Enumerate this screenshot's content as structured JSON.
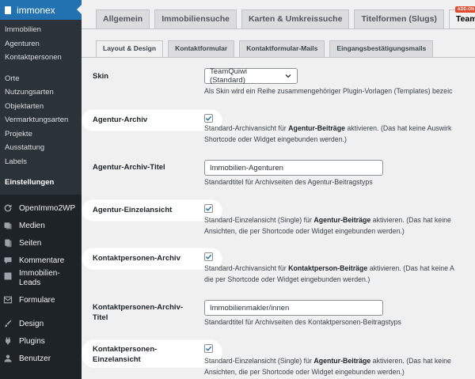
{
  "sidebar": {
    "title": "immonex",
    "submenu": [
      "Immobilien",
      "Agenturen",
      "Kontaktpersonen"
    ],
    "submenu2": [
      "Orte",
      "Nutzungsarten",
      "Objektarten",
      "Vermarktungsarten",
      "Projekte",
      "Ausstattung",
      "Labels"
    ],
    "current": "Einstellungen",
    "menu": [
      {
        "label": "OpenImmo2WP",
        "icon": "refresh-icon"
      },
      {
        "label": "Medien",
        "icon": "media-icon"
      },
      {
        "label": "Seiten",
        "icon": "pages-icon"
      },
      {
        "label": "Kommentare",
        "icon": "comments-icon"
      },
      {
        "label": "Immobilien-\nLeads",
        "icon": "leads-icon"
      },
      {
        "label": "Formulare",
        "icon": "forms-icon"
      },
      {
        "label": "Design",
        "icon": "brush-icon"
      },
      {
        "label": "Plugins",
        "icon": "plugin-icon"
      },
      {
        "label": "Benutzer",
        "icon": "user-icon"
      }
    ]
  },
  "tabs_primary": [
    "Allgemein",
    "Immobiliensuche",
    "Karten & Umkreissuche",
    "Titelformen (Slugs)",
    "Team"
  ],
  "tabs_primary_active": "Team",
  "addon_badge": "ADD-ON",
  "tabs_secondary": [
    "Layout & Design",
    "Kontaktformular",
    "Kontaktformular-Mails",
    "Eingangsbestätigungsmails"
  ],
  "tabs_secondary_active": "Layout & Design",
  "settings": {
    "skin_label": "Skin",
    "skin_value": "TeamQuiwi (Standard)",
    "skin_desc": "Als Skin wird ein Reihe zusammengehöriger Plugin-Vorlagen (Templates) bezeic",
    "archive_label": "Agentur-Archiv",
    "archive_desc1_a": "Standard-Archivansicht für ",
    "archive_desc1_b": "Agentur-Beiträge",
    "archive_desc1_c": " aktivieren. (Das hat keine Auswirk",
    "archive_desc2": "Shortcode oder Widget eingebunden werden.)",
    "archive_title_label": "Agentur-Archiv-Titel",
    "archive_title_value": "Immobilien-Agenturen",
    "archive_title_desc": "Standardtitel für Archivseiten des Agentur-Beitragstyps",
    "single_label": "Agentur-Einzelansicht",
    "single_desc1_a": "Standard-Einzelansicht (Single) für ",
    "single_desc1_b": "Agentur-Beiträge",
    "single_desc1_c": " aktivieren. (Das hat keine",
    "single_desc2": "Ansichten, die per Shortcode oder Widget eingebunden werden.)",
    "contact_archive_label": "Kontaktpersonen-Archiv",
    "contact_archive_desc1_a": "Standard-Archivansicht für ",
    "contact_archive_desc1_b": "Kontaktperson-Beiträge",
    "contact_archive_desc1_c": " aktivieren. (Das hat keine A",
    "contact_archive_desc2": "die per Shortcode oder Widget eingebunden werden.)",
    "contact_title_label_1": "Kontaktpersonen-Archiv-",
    "contact_title_label_2": "Titel",
    "contact_title_value": "Immobilienmakler/innen",
    "contact_title_desc": "Standardtitel für Archivseiten des Kontaktpersonen-Beitragstyps",
    "contact_single_label_1": "Kontaktpersonen-",
    "contact_single_label_2": "Einzelansicht",
    "contact_single_desc1_a": "Standard-Einzelansicht (Single) für ",
    "contact_single_desc1_b": "Agentur-Beiträge",
    "contact_single_desc1_c": " aktivieren. (Das hat keine",
    "contact_single_desc2": "Ansichten, die per Shortcode oder Widget eingebunden werden.)"
  },
  "colors": {
    "sidebar": "#1d2327",
    "accent": "#2271b1",
    "badge": "#e04b2e",
    "checkbox": "#2271b1"
  }
}
